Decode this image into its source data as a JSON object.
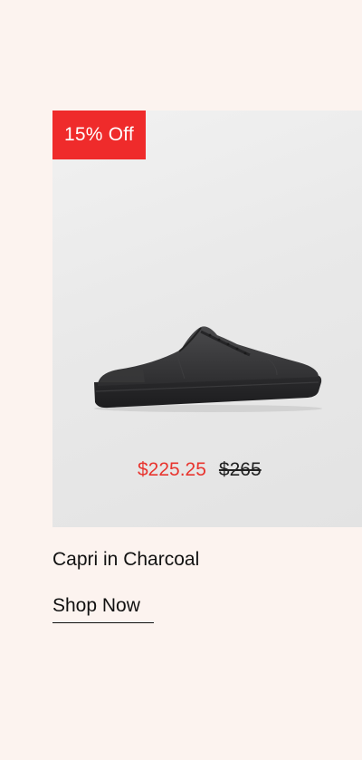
{
  "product": {
    "badge": "15% Off",
    "sale_price": "$225.25",
    "original_price": "$265",
    "name": "Capri in Charcoal",
    "image_alt": "charcoal low-top sneaker",
    "cta_label": "Shop Now"
  },
  "colors": {
    "background": "#fcf3ef",
    "badge": "#ef2b2b",
    "sale_price": "#e8352f"
  }
}
